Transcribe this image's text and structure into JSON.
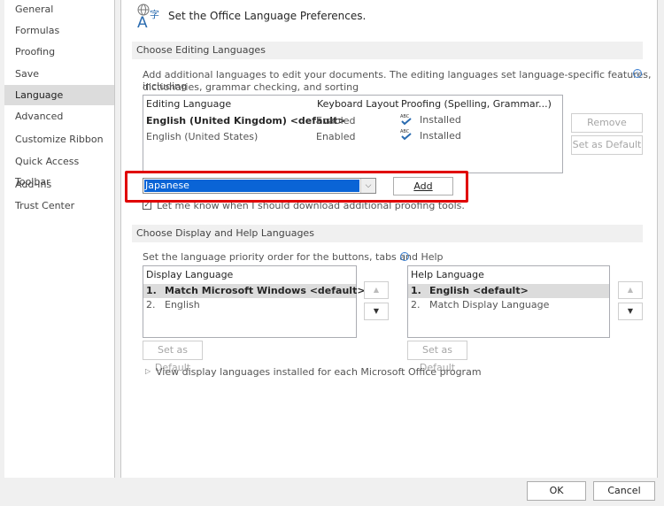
{
  "sidebar": {
    "items": [
      {
        "label": "General"
      },
      {
        "label": "Formulas"
      },
      {
        "label": "Proofing"
      },
      {
        "label": "Save"
      },
      {
        "label": "Language",
        "selected": true
      },
      {
        "label": "Advanced"
      },
      {
        "label": "Customize Ribbon"
      },
      {
        "label": "Quick Access Toolbar"
      },
      {
        "label": "Add-Ins"
      },
      {
        "label": "Trust Center"
      }
    ]
  },
  "header": {
    "title": "Set the Office Language Preferences.",
    "icon": "language-icon"
  },
  "editing": {
    "section_title": "Choose Editing Languages",
    "description_line1": "Add additional languages to edit your documents. The editing languages set language-specific features, including",
    "description_line2": "dictionaries, grammar checking, and sorting",
    "columns": [
      "Editing Language",
      "Keyboard Layout",
      "Proofing (Spelling, Grammar...)"
    ],
    "rows": [
      {
        "language": "English (United Kingdom) <default>",
        "keyboard": "Enabled",
        "proofing": "Installed"
      },
      {
        "language": "English (United States)",
        "keyboard": "Enabled",
        "proofing": "Installed"
      }
    ],
    "remove_label": "Remove",
    "set_default_label": "Set as Default",
    "dropdown_value": "Japanese",
    "add_label": "Add",
    "checkbox_label": "Let me know when I should download additional proofing tools.",
    "checkbox_checked": true,
    "highlight_color": "#e00000"
  },
  "display": {
    "section_title": "Choose Display and Help Languages",
    "description": "Set the language priority order for the buttons, tabs and Help",
    "display_header": "Display Language",
    "display_items": [
      {
        "num": "1.",
        "label": "Match Microsoft Windows <default>"
      },
      {
        "num": "2.",
        "label": "English"
      }
    ],
    "help_header": "Help Language",
    "help_items": [
      {
        "num": "1.",
        "label": "English <default>"
      },
      {
        "num": "2.",
        "label": "Match Display Language"
      }
    ],
    "set_default_label": "Set as Default",
    "view_link": "View display languages installed for each Microsoft Office program"
  },
  "footer": {
    "ok_label": "OK",
    "cancel_label": "Cancel"
  }
}
